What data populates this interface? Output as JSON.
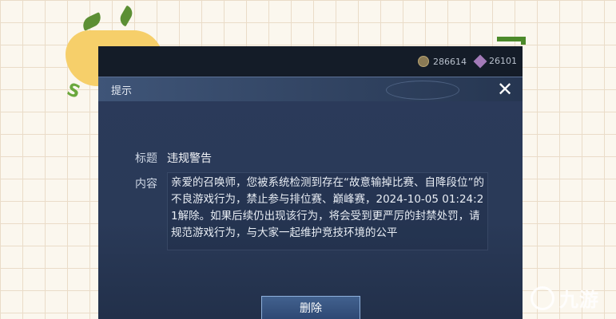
{
  "top_bar": {
    "coins": "286614",
    "gems": "26101"
  },
  "dialog": {
    "title": "提示",
    "close_symbol": "✕",
    "subject_label": "标题",
    "subject_value": "违规警告",
    "content_label": "内容",
    "content_text": "亲爱的召唤师，您被系统检测到存在“故意输掉比赛、自降段位”的不良游戏行为，禁止参与排位赛、巅峰赛，2024-10-05 01:24:21解除。如果后续仍出现该行为，将会受到更严厉的封禁处罚，请规范游戏行为，与大家一起维护竞技环境的公平",
    "delete_label": "删除"
  },
  "watermark": {
    "text": "九游"
  },
  "icons": {
    "coin": "coin-icon",
    "gem": "gem-icon",
    "close": "close-icon"
  }
}
